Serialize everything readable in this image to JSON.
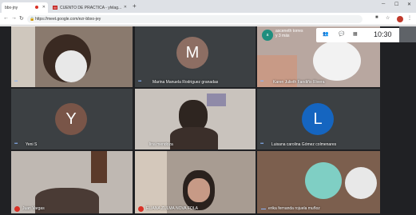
{
  "browser": {
    "tabs": [
      {
        "label": "bbx-jny"
      },
      {
        "label": "CUENTO DE PRACTICA - ylvlag..."
      }
    ],
    "url": "https://meet.google.com/ezr-bbxo-jey"
  },
  "meet": {
    "time": "10:30",
    "speaker_line1": "asceneth torres",
    "speaker_line2": "y 3 más",
    "tiles": [
      {
        "name": ""
      },
      {
        "name": "Marina Manuela Rodriguez granadas",
        "initial": "M"
      },
      {
        "name": "Karen Julieth Fandiño Rivera"
      },
      {
        "name": "Yeni S",
        "initial": "Y"
      },
      {
        "name": "lina mendoza"
      },
      {
        "name": "Luisana carolina Gómez colmenares",
        "initial": "L"
      },
      {
        "name": "Juan Vargas"
      },
      {
        "name": "ELIANA ZULMA NOVA FOLA"
      },
      {
        "name": "erika fernanda rojuela muñoz"
      }
    ]
  },
  "colors": {
    "m_avatar": "#8d6e63",
    "y_avatar": "#795548",
    "l_avatar": "#1565c0"
  }
}
